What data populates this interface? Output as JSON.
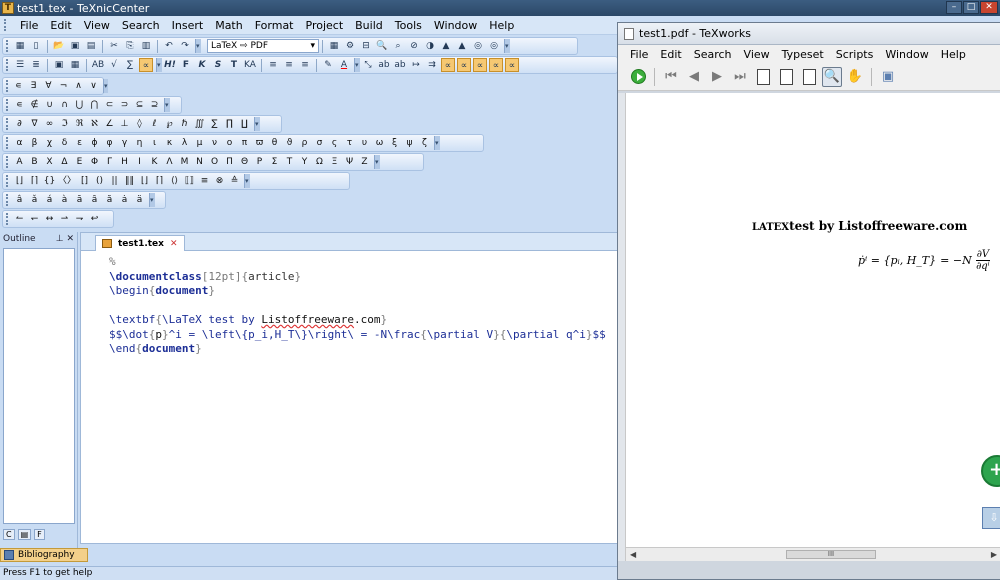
{
  "texnic": {
    "title": "test1.tex - TeXnicCenter",
    "menu": [
      "File",
      "Edit",
      "View",
      "Search",
      "Insert",
      "Math",
      "Format",
      "Project",
      "Build",
      "Tools",
      "Window",
      "Help"
    ],
    "toolbar": {
      "profile_select": "LaTeX ⇨ PDF",
      "format_buttons": [
        "H!",
        "F",
        "K",
        "S",
        "T",
        "KA"
      ]
    },
    "symbol_rows": [
      [
        "∊",
        "∃",
        "∀",
        "¬",
        "∧",
        "∨"
      ],
      [
        "∊",
        "∉",
        "∪",
        "∩",
        "⋃",
        "⋂",
        "⊂",
        "⊃",
        "⊆",
        "⊇"
      ],
      [
        "∂",
        "∇",
        "∞",
        "ℑ",
        "ℜ",
        "ℵ",
        "∠",
        "⊥",
        "◊",
        "ℓ",
        "℘",
        "ℏ",
        "∭",
        "∑",
        "∏",
        "∐"
      ],
      [
        "α",
        "β",
        "χ",
        "δ",
        "ε",
        "ϕ",
        "φ",
        "γ",
        "η",
        "ι",
        "κ",
        "λ",
        "μ",
        "ν",
        "ο",
        "π",
        "ϖ",
        "θ",
        "ϑ",
        "ρ",
        "σ",
        "ς",
        "τ",
        "υ",
        "ω",
        "ξ",
        "ψ",
        "ζ"
      ],
      [
        "Α",
        "Β",
        "Χ",
        "Δ",
        "Ε",
        "Φ",
        "Γ",
        "Η",
        "Ι",
        "Κ",
        "Λ",
        "Μ",
        "Ν",
        "Ο",
        "Π",
        "Θ",
        "Ρ",
        "Σ",
        "Τ",
        "Υ",
        "Ω",
        "Ξ",
        "Ψ",
        "Ζ"
      ],
      [
        "⌊⌋",
        "⌈⌉",
        "{}",
        "〈〉",
        "[]",
        "()",
        "||",
        "‖‖",
        "⌊⌋",
        "⌈⌉",
        "⟨⟩",
        "⟦⟧",
        "≡",
        "⊗",
        "≙"
      ],
      [
        "â",
        "ǎ",
        "á",
        "à",
        "ā",
        "ȃ",
        "ă",
        "ȧ",
        "ä"
      ],
      [
        "↼",
        "↽",
        "↔",
        "⇀",
        "⇁",
        "↩"
      ]
    ],
    "outline": {
      "title": "Outline",
      "pin": "⊥",
      "close": "✕"
    },
    "bottom_tabs": [
      "C",
      "F"
    ],
    "editor": {
      "tab_label": "test1.tex",
      "tab_close": "✕"
    },
    "bibliography_label": "Bibliography",
    "status": "Press F1 to get help"
  },
  "code_lines": {
    "l1": "%",
    "l2_cmd": "\\documentclass",
    "l2_opt": "12pt",
    "l2_arg": "article",
    "l3_cmd": "\\begin",
    "l3_arg": "document",
    "l5_cmd": "\\textbf",
    "l5_text1": "\\LaTeX test by ",
    "l5_text2": "Listoffreeware",
    "l5_text3": ".com",
    "l6a": "$$\\dot",
    "l6b": "p",
    "l6c": "^i = \\left\\{p_i,H_T\\}\\right\\ = -N\\frac",
    "l6d": "\\partial V",
    "l6e": "\\partial q^i",
    "l6f": "$$",
    "l7_cmd": "\\end",
    "l7_arg": "document"
  },
  "texworks": {
    "title": "test1.pdf - TeXworks",
    "menu": [
      "File",
      "Edit",
      "Search",
      "View",
      "Typeset",
      "Scripts",
      "Window",
      "Help"
    ],
    "pdf": {
      "heading_logo": "LATEX",
      "heading_rest": "test by Listoffreeware.com",
      "eq_lhs": "ṗⁱ = {pᵢ, H_T}",
      "eq_mid": "= −N",
      "eq_num": "∂V",
      "eq_den": "∂qⁱ"
    },
    "scroll_thumb": "III"
  },
  "colors": {
    "ribbon_bg": "#c9dcf3",
    "title_bg": "#2b4867",
    "keyword": "#1c2e96",
    "highlight": "#f6c872"
  },
  "icons": {
    "play": "play-icon",
    "zoom": "magnifier-icon",
    "hand": "hand-icon"
  }
}
